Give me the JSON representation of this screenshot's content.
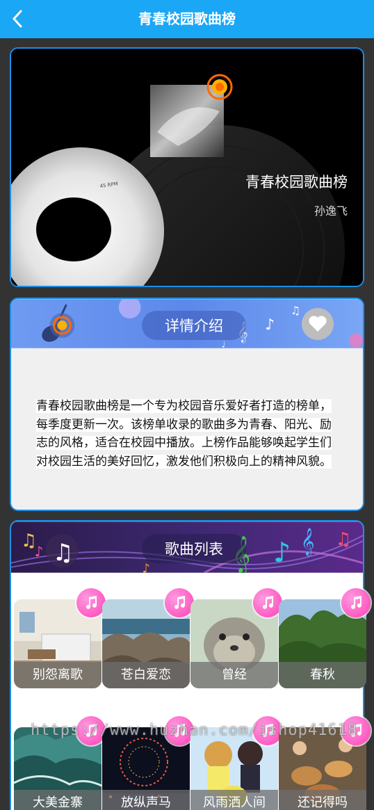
{
  "header": {
    "title": "青春校园歌曲榜",
    "back_icon": "chevron-left-icon"
  },
  "cover": {
    "title": "青春校园歌曲榜",
    "author": "孙逸飞"
  },
  "detail": {
    "section_title": "详情介绍",
    "favorite_icon": "heart-icon",
    "description": "青春校园歌曲榜是一个专为校园音乐爱好者打造的榜单，每季度更新一次。该榜单收录的歌曲多为青春、阳光、励志的风格，适合在校园中播放。上榜作品能够唤起学生们对校园生活的美好回忆，激发他们积极向上的精神风貌。"
  },
  "songs": {
    "section_title": "歌曲列表",
    "items": [
      {
        "title": "别怨离歌"
      },
      {
        "title": "苍白爱恋"
      },
      {
        "title": "曾经"
      },
      {
        "title": "春秋"
      },
      {
        "title": "大美金寨"
      },
      {
        "title": "放纵声马"
      },
      {
        "title": "风雨洒人间"
      },
      {
        "title": "还记得吗"
      }
    ]
  },
  "watermark": "https://www.huzhan.com/ishop41618",
  "colors": {
    "header_bg": "#1aa7f5",
    "card_border": "#1b8fe8",
    "badge_pink": "#ff3fb5"
  }
}
